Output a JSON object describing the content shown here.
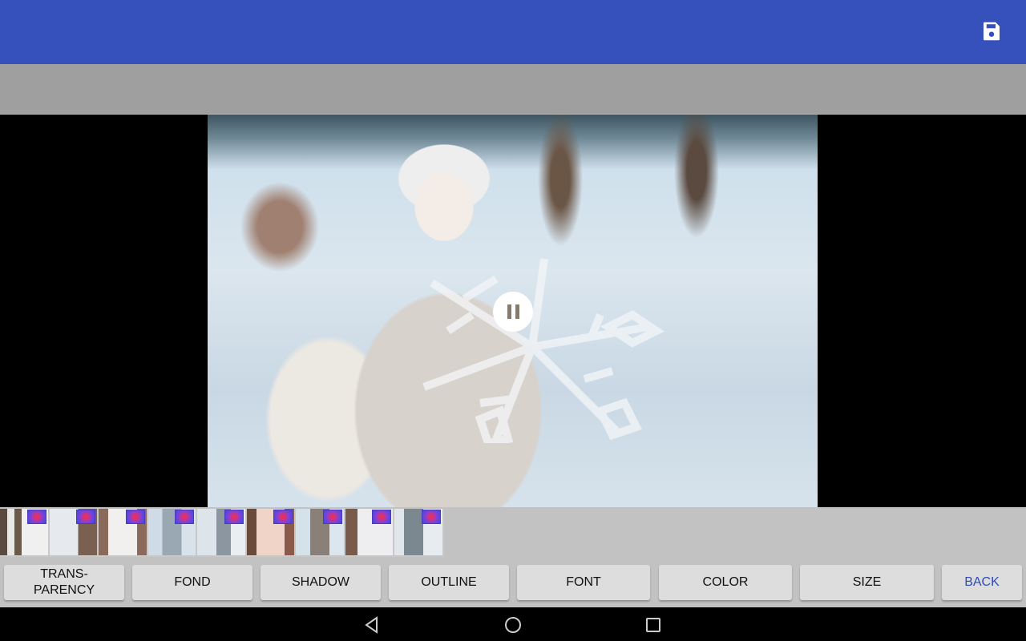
{
  "appbar": {
    "background_color": "#3650BC",
    "actions": [
      {
        "icon": "save-icon",
        "label": "Save"
      }
    ]
  },
  "preview": {
    "image_description": "Woman in white knit hat blowing snow from gloved hands, winter scene",
    "overlay": "Semi-transparent snowflake sticker with photo texture",
    "playback_state": "playing",
    "playback_icon": "pause-icon"
  },
  "thumbnails": {
    "count": 9,
    "items": [
      {
        "description": "snowy forest",
        "effect_badge": true
      },
      {
        "description": "woman in white by tree",
        "effect_badge": true
      },
      {
        "description": "woman smiling in hat",
        "effect_badge": true
      },
      {
        "description": "couple in snow",
        "effect_badge": true
      },
      {
        "description": "woman in snow",
        "effect_badge": true
      },
      {
        "description": "woman with mittens",
        "effect_badge": true
      },
      {
        "description": "woman blowing snow",
        "effect_badge": true
      },
      {
        "description": "woman in white coat",
        "effect_badge": true
      },
      {
        "description": "woman in gray coat",
        "effect_badge": true
      }
    ]
  },
  "toolbar": {
    "buttons": [
      {
        "label": "TRANS-\nPARENCY",
        "line1": "TRANS-",
        "line2": "PARENCY"
      },
      {
        "label": "FOND"
      },
      {
        "label": "SHADOW"
      },
      {
        "label": "OUTLINE"
      },
      {
        "label": "FONT"
      },
      {
        "label": "COLOR"
      },
      {
        "label": "SIZE"
      },
      {
        "label": "BACK",
        "accent_color": "#2F4BB5"
      }
    ]
  },
  "system_nav": {
    "back": "back-icon",
    "home": "home-icon",
    "recents": "recents-icon"
  }
}
